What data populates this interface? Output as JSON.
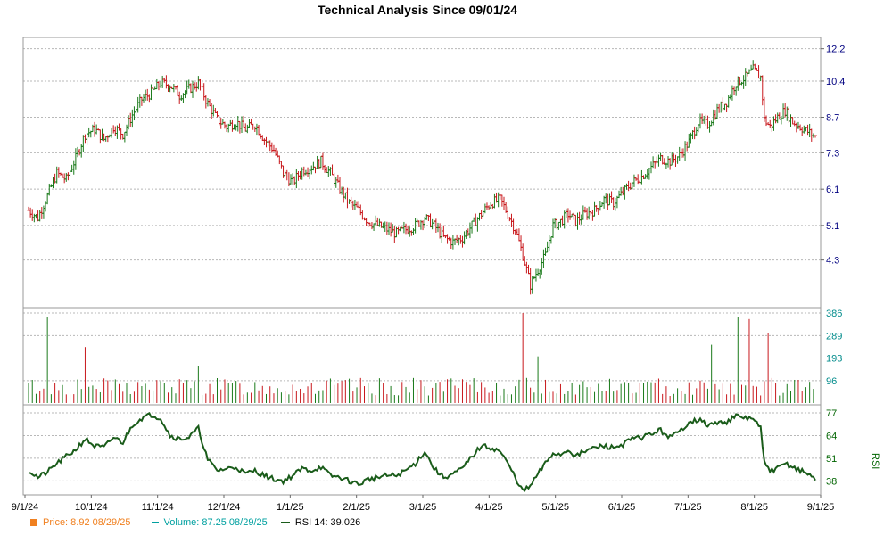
{
  "chart_data": {
    "type": "stock-ohlc-volume-rsi",
    "title": "Technical Analysis Since 09/01/24",
    "colors": {
      "up": "#1a7a1a",
      "down": "#c8181c",
      "price_legend": "#f08020",
      "volume_legend": "#00a0a0",
      "rsi": "#1a5c1a",
      "price_axis": "#000080",
      "volume_axis": "#008b8b",
      "rsi_axis": "#006400"
    },
    "price_axis": {
      "scale": "log",
      "ticks": [
        "12.2",
        "10.4",
        "8.7",
        "7.3",
        "6.1",
        "5.1",
        "4.3"
      ],
      "ylim": [
        3.4,
        12.9
      ]
    },
    "volume_axis": {
      "ticks": [
        "386",
        "289",
        "193",
        "96"
      ],
      "ylim": [
        0,
        386
      ]
    },
    "rsi_axis": {
      "label": "RSI",
      "ticks": [
        "77",
        "64",
        "51",
        "38"
      ],
      "ylim": [
        30,
        77
      ]
    },
    "x_ticks": [
      "9/1/24",
      "10/1/24",
      "11/1/24",
      "12/1/24",
      "1/1/25",
      "2/1/25",
      "3/1/25",
      "4/1/25",
      "5/1/25",
      "6/1/25",
      "7/1/25",
      "8/1/25",
      "9/1/25"
    ],
    "price_anchors": [
      [
        0,
        5.5
      ],
      [
        5,
        5.3
      ],
      [
        10,
        5.9
      ],
      [
        15,
        6.6
      ],
      [
        20,
        6.4
      ],
      [
        25,
        7.1
      ],
      [
        30,
        8.0
      ],
      [
        35,
        8.2
      ],
      [
        40,
        7.8
      ],
      [
        45,
        8.3
      ],
      [
        50,
        8.0
      ],
      [
        55,
        8.8
      ],
      [
        60,
        9.5
      ],
      [
        65,
        9.8
      ],
      [
        70,
        10.3
      ],
      [
        75,
        10.2
      ],
      [
        80,
        9.7
      ],
      [
        85,
        10.0
      ],
      [
        90,
        10.3
      ],
      [
        95,
        9.3
      ],
      [
        100,
        8.6
      ],
      [
        105,
        8.3
      ],
      [
        110,
        8.5
      ],
      [
        115,
        8.2
      ],
      [
        120,
        8.4
      ],
      [
        125,
        7.8
      ],
      [
        130,
        7.4
      ],
      [
        135,
        6.6
      ],
      [
        140,
        6.3
      ],
      [
        145,
        6.7
      ],
      [
        150,
        6.8
      ],
      [
        155,
        7.0
      ],
      [
        160,
        6.6
      ],
      [
        165,
        6.1
      ],
      [
        170,
        5.7
      ],
      [
        175,
        5.5
      ],
      [
        180,
        5.2
      ],
      [
        185,
        5.1
      ],
      [
        190,
        5.0
      ],
      [
        195,
        4.9
      ],
      [
        200,
        5.0
      ],
      [
        205,
        5.1
      ],
      [
        210,
        5.3
      ],
      [
        215,
        5.1
      ],
      [
        220,
        4.8
      ],
      [
        225,
        4.7
      ],
      [
        230,
        4.8
      ],
      [
        235,
        5.1
      ],
      [
        240,
        5.4
      ],
      [
        245,
        5.7
      ],
      [
        250,
        5.8
      ],
      [
        255,
        5.3
      ],
      [
        258,
        5.0
      ],
      [
        262,
        4.4
      ],
      [
        266,
        3.8
      ],
      [
        270,
        4.1
      ],
      [
        274,
        4.4
      ],
      [
        278,
        5.1
      ],
      [
        282,
        5.2
      ],
      [
        286,
        5.4
      ],
      [
        290,
        5.2
      ],
      [
        295,
        5.4
      ],
      [
        300,
        5.5
      ],
      [
        305,
        5.8
      ],
      [
        310,
        5.7
      ],
      [
        315,
        6.0
      ],
      [
        320,
        6.3
      ],
      [
        325,
        6.5
      ],
      [
        330,
        6.8
      ],
      [
        335,
        7.1
      ],
      [
        340,
        7.0
      ],
      [
        345,
        7.2
      ],
      [
        350,
        7.7
      ],
      [
        355,
        8.5
      ],
      [
        360,
        8.4
      ],
      [
        365,
        9.0
      ],
      [
        370,
        9.4
      ],
      [
        375,
        10.3
      ],
      [
        380,
        10.6
      ],
      [
        384,
        11.0
      ],
      [
        388,
        10.6
      ],
      [
        390,
        8.6
      ],
      [
        393,
        8.3
      ],
      [
        397,
        8.7
      ],
      [
        401,
        9.0
      ],
      [
        405,
        8.5
      ],
      [
        409,
        8.3
      ],
      [
        413,
        8.1
      ],
      [
        417,
        7.9
      ]
    ],
    "volume_spikes": [
      [
        10,
        370
      ],
      [
        30,
        240
      ],
      [
        90,
        160
      ],
      [
        165,
        150
      ],
      [
        195,
        110
      ],
      [
        245,
        150
      ],
      [
        262,
        386
      ],
      [
        270,
        200
      ],
      [
        345,
        150
      ],
      [
        362,
        250
      ],
      [
        369,
        230
      ],
      [
        376,
        370
      ],
      [
        382,
        360
      ],
      [
        387,
        340
      ],
      [
        392,
        300
      ],
      [
        409,
        200
      ]
    ],
    "volume_base": 60,
    "rsi_anchors": [
      [
        0,
        44
      ],
      [
        5,
        40
      ],
      [
        10,
        43
      ],
      [
        15,
        48
      ],
      [
        20,
        52
      ],
      [
        25,
        56
      ],
      [
        30,
        62
      ],
      [
        35,
        58
      ],
      [
        40,
        57
      ],
      [
        45,
        63
      ],
      [
        50,
        60
      ],
      [
        55,
        70
      ],
      [
        60,
        74
      ],
      [
        65,
        76
      ],
      [
        70,
        74
      ],
      [
        75,
        64
      ],
      [
        80,
        62
      ],
      [
        85,
        63
      ],
      [
        90,
        68
      ],
      [
        95,
        50
      ],
      [
        100,
        44
      ],
      [
        105,
        45
      ],
      [
        110,
        46
      ],
      [
        115,
        42
      ],
      [
        120,
        44
      ],
      [
        125,
        41
      ],
      [
        130,
        39
      ],
      [
        135,
        38
      ],
      [
        140,
        41
      ],
      [
        145,
        45
      ],
      [
        150,
        44
      ],
      [
        155,
        46
      ],
      [
        160,
        41
      ],
      [
        165,
        40
      ],
      [
        170,
        38
      ],
      [
        175,
        36
      ],
      [
        180,
        39
      ],
      [
        185,
        40
      ],
      [
        190,
        41
      ],
      [
        195,
        41
      ],
      [
        200,
        44
      ],
      [
        205,
        48
      ],
      [
        210,
        55
      ],
      [
        215,
        45
      ],
      [
        220,
        40
      ],
      [
        225,
        42
      ],
      [
        230,
        45
      ],
      [
        235,
        52
      ],
      [
        240,
        58
      ],
      [
        245,
        57
      ],
      [
        250,
        55
      ],
      [
        255,
        46
      ],
      [
        258,
        40
      ],
      [
        262,
        32
      ],
      [
        266,
        35
      ],
      [
        270,
        42
      ],
      [
        274,
        48
      ],
      [
        278,
        54
      ],
      [
        282,
        53
      ],
      [
        286,
        56
      ],
      [
        290,
        52
      ],
      [
        295,
        55
      ],
      [
        300,
        57
      ],
      [
        305,
        58
      ],
      [
        310,
        57
      ],
      [
        315,
        59
      ],
      [
        320,
        62
      ],
      [
        325,
        63
      ],
      [
        330,
        65
      ],
      [
        335,
        67
      ],
      [
        340,
        63
      ],
      [
        345,
        66
      ],
      [
        350,
        72
      ],
      [
        355,
        73
      ],
      [
        360,
        70
      ],
      [
        365,
        71
      ],
      [
        370,
        72
      ],
      [
        375,
        75
      ],
      [
        380,
        74
      ],
      [
        384,
        74
      ],
      [
        388,
        68
      ],
      [
        390,
        48
      ],
      [
        393,
        44
      ],
      [
        397,
        45
      ],
      [
        401,
        48
      ],
      [
        405,
        46
      ],
      [
        409,
        44
      ],
      [
        413,
        42
      ],
      [
        417,
        39
      ]
    ],
    "n_bars": 418,
    "legend": {
      "price": "Price: 8.92  08/29/25",
      "volume": "Volume: 87.25  08/29/25",
      "rsi": "RSI 14: 39.026"
    }
  }
}
